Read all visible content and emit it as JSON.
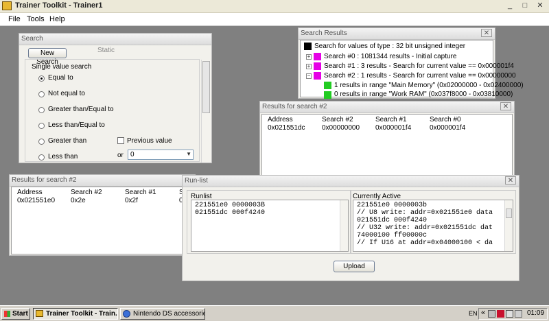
{
  "app": {
    "title": "Trainer Toolkit - Trainer1",
    "minimize": "_",
    "maximize": "□",
    "close": "✕"
  },
  "menu": [
    "File",
    "Tools",
    "Help"
  ],
  "search_window": {
    "title": "Search",
    "new_search_label": "New Search",
    "static_label": "Static",
    "group_label": "Single value search",
    "options": [
      {
        "label": "Equal to",
        "selected": true
      },
      {
        "label": "Not equal to",
        "selected": false
      },
      {
        "label": "Greater than/Equal to",
        "selected": false
      },
      {
        "label": "Less than/Equal to",
        "selected": false
      },
      {
        "label": "Greater than",
        "selected": false
      },
      {
        "label": "Less than",
        "selected": false
      }
    ],
    "previous_value_label": "Previous value",
    "or_label": "or",
    "value": "0",
    "dropdown_arrow": "▼"
  },
  "search_results": {
    "title": "Search Results",
    "close": "✕",
    "items": [
      {
        "text": "Search for values of type : 32 bit unsigned integer",
        "color": "#000000",
        "level": 0,
        "expander": ""
      },
      {
        "text": "Search #0 : 1081344 results - Initial capture",
        "color": "#E600E6",
        "level": 1,
        "expander": "+"
      },
      {
        "text": "Search #1 : 3 results - Search for current value == 0x000001f4",
        "color": "#E600E6",
        "level": 1,
        "expander": "+"
      },
      {
        "text": "Search #2 : 1 results - Search for current value == 0x00000000",
        "color": "#E600E6",
        "level": 1,
        "expander": "−"
      },
      {
        "text": "1 results in range \"Main Memory\" (0x02000000 - 0x02400000)",
        "color": "#22CC22",
        "level": 2,
        "expander": ""
      },
      {
        "text": "0 results in range \"Work RAM\" (0x037f8000 - 0x03810000)",
        "color": "#22CC22",
        "level": 2,
        "expander": ""
      }
    ]
  },
  "results_a": {
    "title": "Results for search #2",
    "close": "✕",
    "headers": [
      "Address",
      "Search #2",
      "Search #1",
      "Search #0"
    ],
    "rows": [
      [
        "0x021551dc",
        "0x00000000",
        "0x000001f4",
        "0x000001f4"
      ]
    ]
  },
  "results_b": {
    "title": "Results for search #2",
    "headers": [
      "Address",
      "Search #2",
      "Search #1",
      "S"
    ],
    "rows": [
      [
        "0x021551e0",
        "0x2e",
        "0x2f",
        "0"
      ]
    ]
  },
  "runlist": {
    "title": "Run-list",
    "close": "✕",
    "runlist_label": "Runlist",
    "active_label": "Currently Active",
    "runlist_lines": [
      "221551e0 0000003B",
      "021551dc 000f4240"
    ],
    "active_lines": [
      "221551e0 0000003b",
      "// U8 write: addr=0x021551e0 data",
      "021551dc 000f4240",
      "// U32 write: addr=0x021551dc dat",
      "74000100 ff00000c",
      "// If U16 at addr=0x04000100 < da"
    ],
    "upload_label": "Upload"
  },
  "taskbar": {
    "start_label": "Start",
    "tasks": [
      {
        "label": "Trainer Toolkit - Train...",
        "active": true
      },
      {
        "label": "Nintendo DS accessories ...",
        "active": false
      }
    ],
    "lang": "EN",
    "chevron": "«",
    "clock": "01:09"
  },
  "colors": {
    "mdi_bg": "#808080",
    "accent_magenta": "#E600E6",
    "accent_green": "#22CC22"
  }
}
